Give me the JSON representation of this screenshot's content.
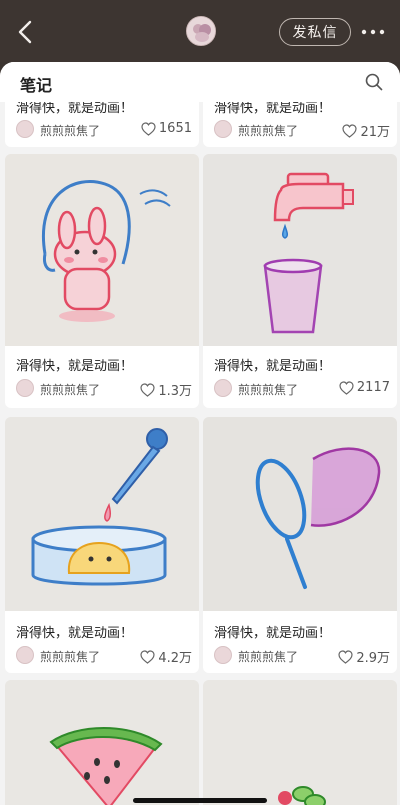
{
  "header": {
    "back_icon": "chevron-left-icon",
    "dm_label": "发私信",
    "more_icon": "ellipsis-icon"
  },
  "sheet": {
    "title": "笔记",
    "search_icon": "search-icon"
  },
  "notes": [
    {
      "title": "滑得快，就是动画！",
      "author": "煎煎煎焦了",
      "likes": "1651",
      "image": "partially-hidden"
    },
    {
      "title": "滑得快，就是动画！",
      "author": "煎煎煎焦了",
      "likes": "21万",
      "image": "partially-hidden"
    },
    {
      "title": "滑得快，就是动画！",
      "author": "煎煎煎焦了",
      "likes": "1.3万",
      "image": "rabbit-jump-rope-drawing"
    },
    {
      "title": "滑得快，就是动画！",
      "author": "煎煎煎焦了",
      "likes": "2117",
      "image": "faucet-and-glass-drawing"
    },
    {
      "title": "滑得快，就是动画！",
      "author": "煎煎煎焦了",
      "likes": "4.2万",
      "image": "dropper-and-dish-drawing"
    },
    {
      "title": "滑得快，就是动画！",
      "author": "煎煎煎焦了",
      "likes": "2.9万",
      "image": "butterfly-net-drawing"
    },
    {
      "title": "",
      "author": "",
      "likes": "",
      "image": "watermelon-slice-drawing"
    },
    {
      "title": "",
      "author": "",
      "likes": "",
      "image": "flower-drawing"
    }
  ],
  "colors": {
    "topbar": "#3d3531",
    "sheet_bg": "#f3f3f3",
    "card_bg": "#ffffff"
  }
}
